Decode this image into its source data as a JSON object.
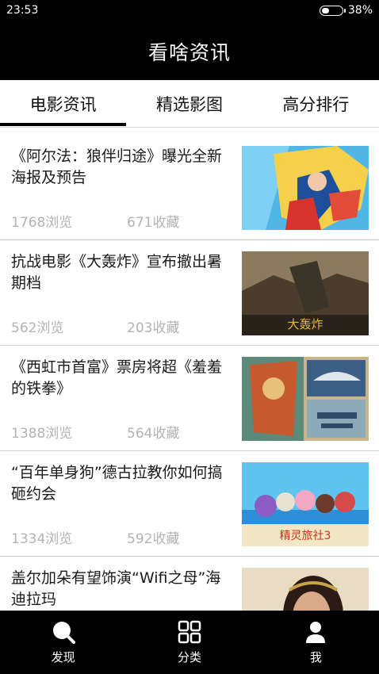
{
  "status": {
    "time": "23:53",
    "battery": "38%",
    "battery_level": 0.38
  },
  "header": {
    "title": "看啥资讯"
  },
  "tabs": [
    {
      "label": "电影资讯",
      "active": true
    },
    {
      "label": "精选影图",
      "active": false
    },
    {
      "label": "高分排行",
      "active": false
    }
  ],
  "news": [
    {
      "title": "《阿尔法：狼伴归途》曝光全新海报及预告",
      "views": "1768浏览",
      "favorites": "671收藏",
      "thumb_icon": "comic-heroine-poster"
    },
    {
      "title": "抗战电影《大轰炸》宣布撤出暑期档",
      "views": "562浏览",
      "favorites": "203收藏",
      "thumb_icon": "war-film-poster",
      "thumb_text": "大轰炸"
    },
    {
      "title": "《西虹市首富》票房将超《羞羞的铁拳》",
      "views": "1388浏览",
      "favorites": "564收藏",
      "thumb_icon": "collage-poster"
    },
    {
      "title": "“百年单身狗”德古拉教你如何搞砸约会",
      "views": "1334浏览",
      "favorites": "592收藏",
      "thumb_icon": "animated-film-poster",
      "thumb_text": "精灵旅社3"
    },
    {
      "title": "盖尔加朵有望饰演“Wifi之母”海迪拉玛",
      "views": "",
      "favorites": "",
      "thumb_icon": "actress-portrait"
    }
  ],
  "bottom_nav": [
    {
      "label": "发现",
      "icon": "search-icon"
    },
    {
      "label": "分类",
      "icon": "grid-icon"
    },
    {
      "label": "我",
      "icon": "user-icon"
    }
  ],
  "colors": {
    "bar": "#000000",
    "meta_text": "#b3b3b3",
    "divider": "#cfcfcf"
  }
}
